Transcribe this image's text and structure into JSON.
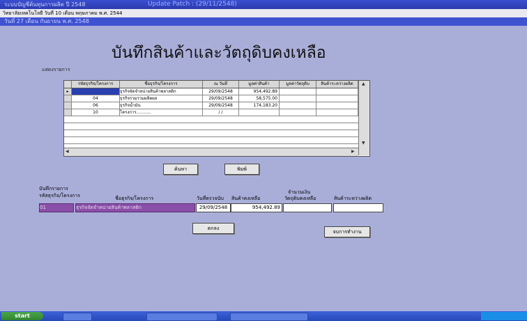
{
  "window": {
    "title": "ระบบบัญชีต้นทุนการผลิต ปี 2548",
    "update_text": "Update Patch : (29/11/2548)"
  },
  "menu": {
    "text": "วิทยาลัยเทคโนโลยี วันที่ 10 เดือน พฤษภาคม พ.ศ. 2544"
  },
  "date_bar": {
    "text": "วันที่ 27 เดือน กันยายน พ.ศ. 2548"
  },
  "page": {
    "title": "บันทึกสินค้าและวัตถุดิบคงเหลือ"
  },
  "list_section": {
    "label": "แสดงรายการ",
    "columns": [
      "รหัสธุรกิจ/โครงการ",
      "ชื่อธุรกิจ/โครงการ",
      "ณ วันที่",
      "มูลค่าสินค้า",
      "มูลค่าวัตถุดิบ",
      "สินค้าระหว่างผลิต"
    ],
    "rows": [
      {
        "code": "",
        "name": "ธุรกิจจัดจำหน่ายสินค้าพลาสติก",
        "date": "29/09/2548",
        "goods": "954,492.89",
        "materials": "",
        "wip": ""
      },
      {
        "code": "04",
        "name": "ธุรกิจรวมรวมผลิตผล",
        "date": "29/09/2548",
        "goods": "58,575.00",
        "materials": "",
        "wip": ""
      },
      {
        "code": "06",
        "name": "ธุรกิจน้ำมัน",
        "date": "29/09/2548",
        "goods": "174,183.20",
        "materials": "",
        "wip": ""
      },
      {
        "code": "10",
        "name": "โครงการ...........",
        "date": "/ /",
        "goods": "",
        "materials": "",
        "wip": ""
      }
    ]
  },
  "buttons": {
    "search": "ค้นหา",
    "print": "พิมพ์",
    "save": "ตกลง",
    "close": "จบการทำงาน"
  },
  "entry_section": {
    "label": "บันทึกรายการ",
    "code_label": "รหัสธุรกิจ/โครงการ",
    "name_label": "ชื่อธุรกิจ/โครงการ",
    "date_label": "วันที่ตรวจนับ",
    "goods_label": "สินค้าคงเหลือ",
    "materials_label_1": "จำนวนเงิน",
    "materials_label_2": "วัตถุดิบคงเหลือ",
    "wip_label": "สินค้าระหว่างผลิต",
    "code_value": "01",
    "name_value": "ธุรกิจจัดจำหน่ายสินค้าพลาสติก",
    "date_value": "29/09/2548",
    "goods_value": "954,492.89",
    "materials_value": "",
    "wip_value": ""
  },
  "taskbar": {
    "start": "start"
  },
  "colors": {
    "background": "#a9aed9",
    "title_bar": "#3a4fd0",
    "selected_field": "#8a4fa8"
  }
}
